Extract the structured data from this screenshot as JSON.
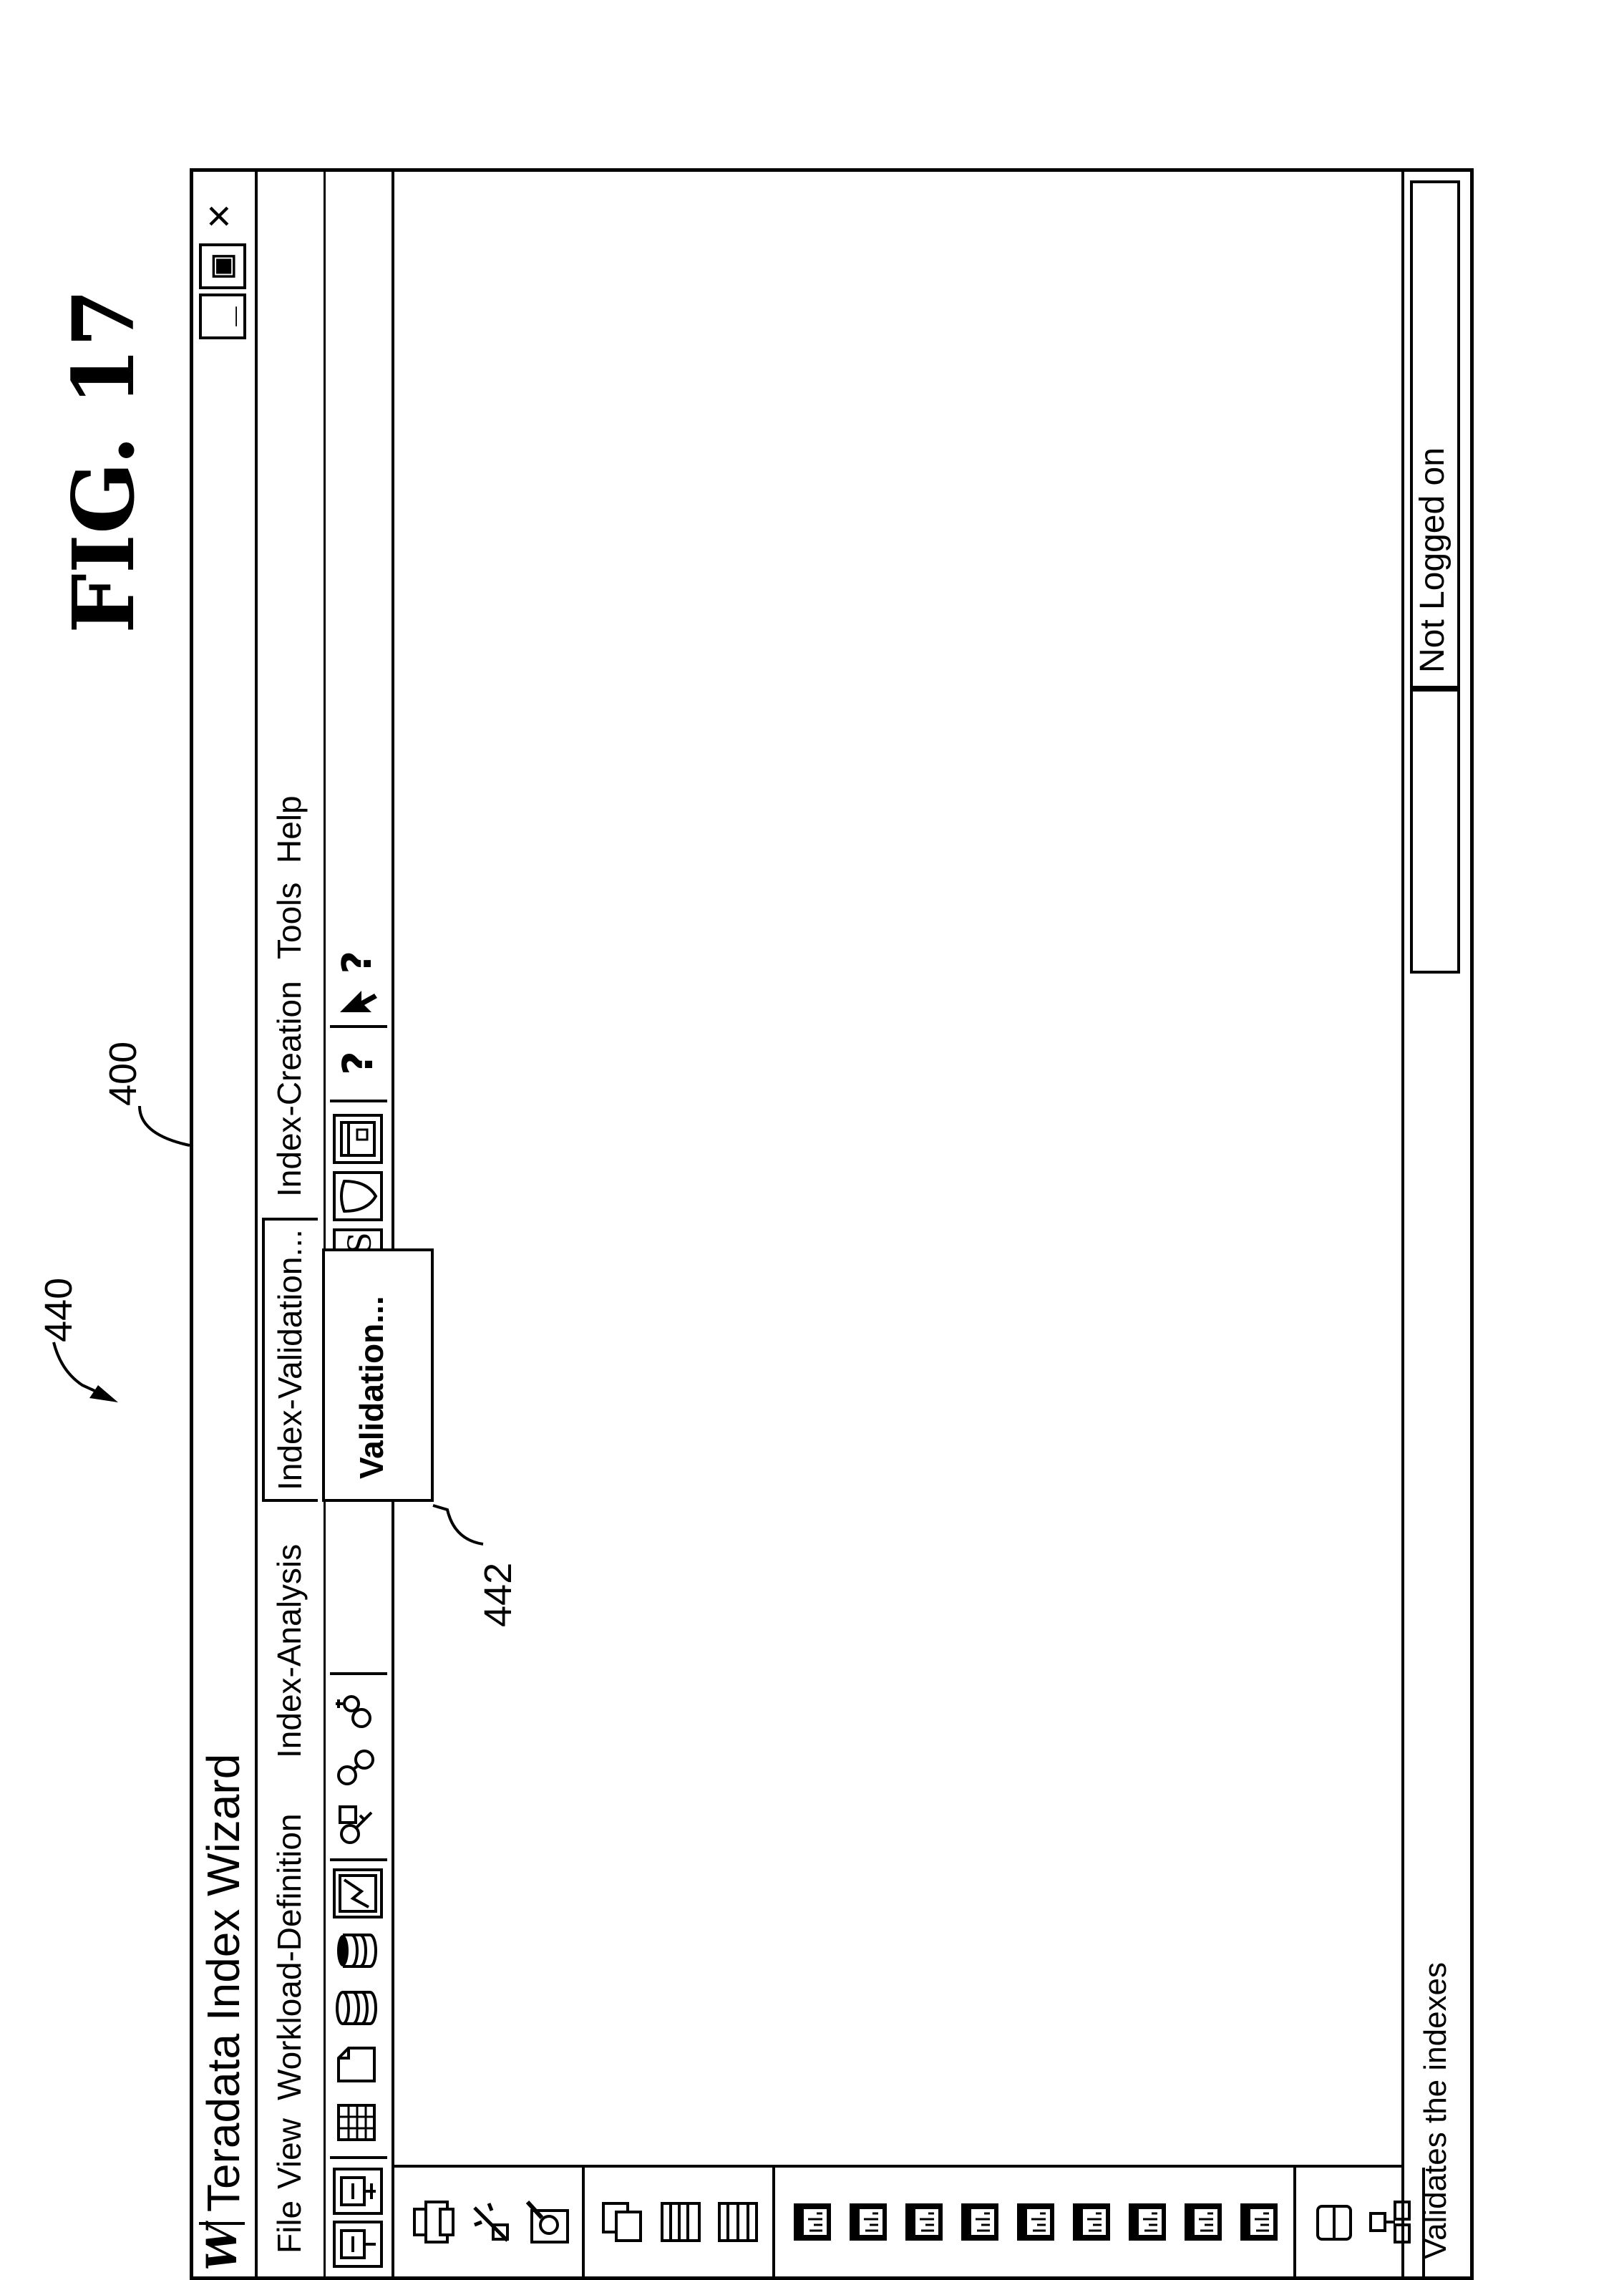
{
  "figure_label": "FIG. 17",
  "window": {
    "title": "Teradata Index Wizard",
    "logo_glyph": "W",
    "controls": {
      "minimize": "_",
      "restore": "▣",
      "close": "×"
    }
  },
  "menu": {
    "items": [
      {
        "label": "File"
      },
      {
        "label": "View"
      },
      {
        "label": "Workload-Definition"
      },
      {
        "label": "Index-Analysis"
      },
      {
        "label": "Index-Validation..."
      },
      {
        "label": "Index-Creation"
      },
      {
        "label": "Tools"
      },
      {
        "label": "Help"
      }
    ],
    "open_menu": "Index-Validation...",
    "dropdown_items": [
      {
        "label": "Validation..."
      }
    ]
  },
  "toolbar": {
    "icons": [
      "connect-icon",
      "disconnect-icon",
      "spreadsheet-icon",
      "new-document-icon",
      "database-icon",
      "database-stack-icon",
      "chart-report-icon",
      "key-search-icon",
      "keys-icon",
      "key-what-if-icon",
      "teradata-statistics-icon",
      "shield-icon",
      "window-icon",
      "help-icon",
      "context-help-icon"
    ],
    "text_buttons": {
      "statistics": "TS",
      "help": "?",
      "context_help": "?"
    }
  },
  "sidebar": {
    "icon_groups": [
      [
        "printer-icon",
        "wizard-icon",
        "search-document-icon"
      ],
      [
        "cascade-windows-icon",
        "tile-horizontal-icon",
        "tile-vertical-icon"
      ],
      [
        "report-1-icon",
        "report-2-icon",
        "report-3-icon",
        "report-4-icon",
        "report-5-icon",
        "report-6-icon",
        "report-7-icon",
        "report-8-icon",
        "report-9-icon"
      ],
      [
        "split-horizontal-icon",
        "tree-icon"
      ]
    ]
  },
  "status_bar": {
    "message": "Validates the indexes",
    "logon": "Not Logged on"
  },
  "reference_numerals": {
    "window": "400",
    "menu": "440",
    "dropdown_item": "442"
  }
}
